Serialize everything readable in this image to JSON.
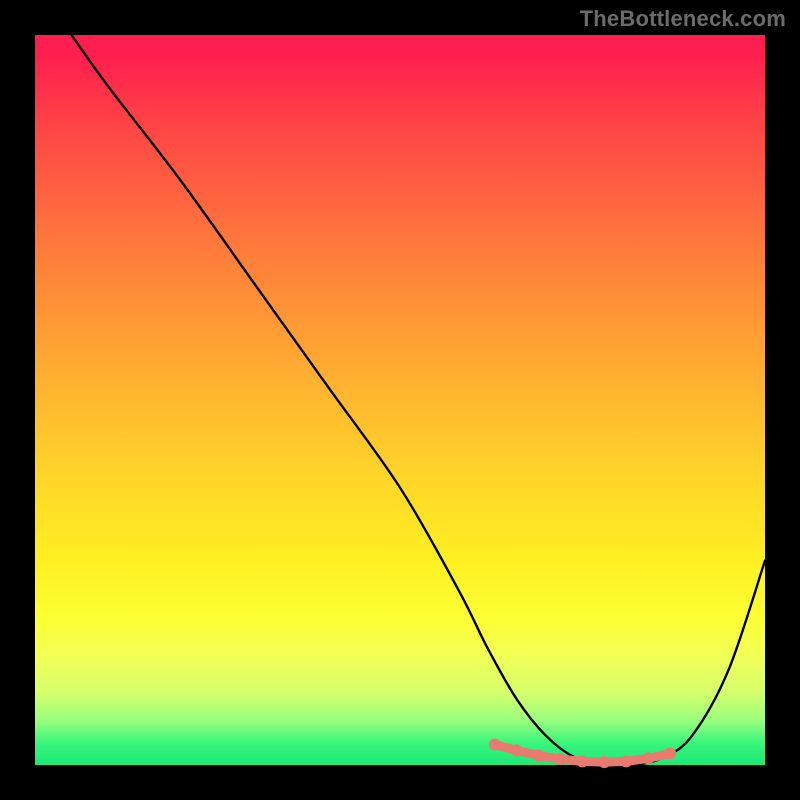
{
  "attribution": "TheBottleneck.com",
  "chart_data": {
    "type": "line",
    "title": "",
    "xlabel": "",
    "ylabel": "",
    "xlim": [
      0,
      100
    ],
    "ylim": [
      0,
      100
    ],
    "grid": false,
    "legend": false,
    "series": [
      {
        "name": "bottleneck-curve",
        "color": "#000000",
        "x": [
          5,
          10,
          20,
          30,
          40,
          50,
          58,
          62,
          66,
          70,
          74,
          78,
          82,
          86,
          90,
          95,
          100
        ],
        "values": [
          100,
          93,
          80,
          66,
          52,
          38,
          24,
          16,
          9,
          4,
          1,
          0,
          0,
          1,
          4,
          13,
          28
        ]
      }
    ],
    "markers": {
      "name": "highlight-band",
      "color": "#e87a70",
      "x": [
        63,
        66,
        69,
        72,
        75,
        78,
        81,
        84,
        87
      ],
      "values": [
        2.8,
        2.0,
        1.3,
        0.8,
        0.5,
        0.4,
        0.5,
        0.9,
        1.6
      ]
    },
    "background_gradient": {
      "top": "#ff1f4e",
      "bottom": "#1de876"
    }
  }
}
